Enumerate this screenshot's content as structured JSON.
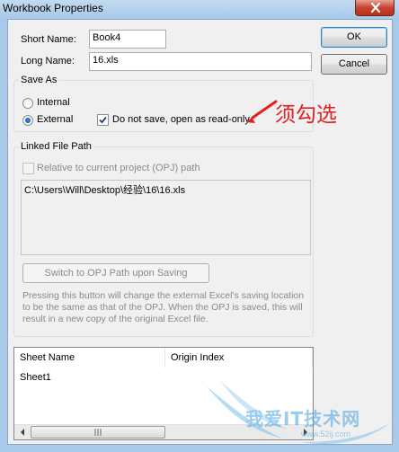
{
  "window": {
    "title": "Workbook Properties"
  },
  "buttons": {
    "ok": "OK",
    "cancel": "Cancel",
    "switch_path": "Switch to OPJ Path upon Saving"
  },
  "fields": {
    "short_name_label": "Short Name:",
    "short_name_value": "Book4",
    "long_name_label": "Long Name:",
    "long_name_value": "16.xls"
  },
  "save_as": {
    "group_label": "Save As",
    "options": [
      "Internal",
      "External"
    ],
    "selected": "External",
    "do_not_save_label": "Do not save, open as read-only",
    "do_not_save_checked": true
  },
  "linked_path": {
    "group_label": "Linked File Path",
    "relative_label": "Relative to current project (OPJ) path",
    "relative_checked": false,
    "path": "C:\\Users\\Will\\Desktop\\经验\\16\\16.xls",
    "help_text": "Pressing this button will change the external Excel's saving location to be the same as that of the OPJ. When the OPJ is saved, this will result in a new copy of the original Excel file."
  },
  "sheet_list": {
    "columns": [
      "Sheet Name",
      "Origin Index"
    ],
    "rows": [
      {
        "sheet_name": "Sheet1",
        "origin_index": ""
      }
    ]
  },
  "annotation": {
    "text": "须勾选",
    "color": "#e02020"
  },
  "watermark": {
    "text": "我爱IT技术网",
    "sub": "www.52ij.com"
  },
  "icons": {
    "close": "close-icon",
    "check": "checkmark-icon",
    "arrow": "red-arrow-icon",
    "scroll_left": "chevron-left-icon",
    "scroll_right": "chevron-right-icon"
  }
}
